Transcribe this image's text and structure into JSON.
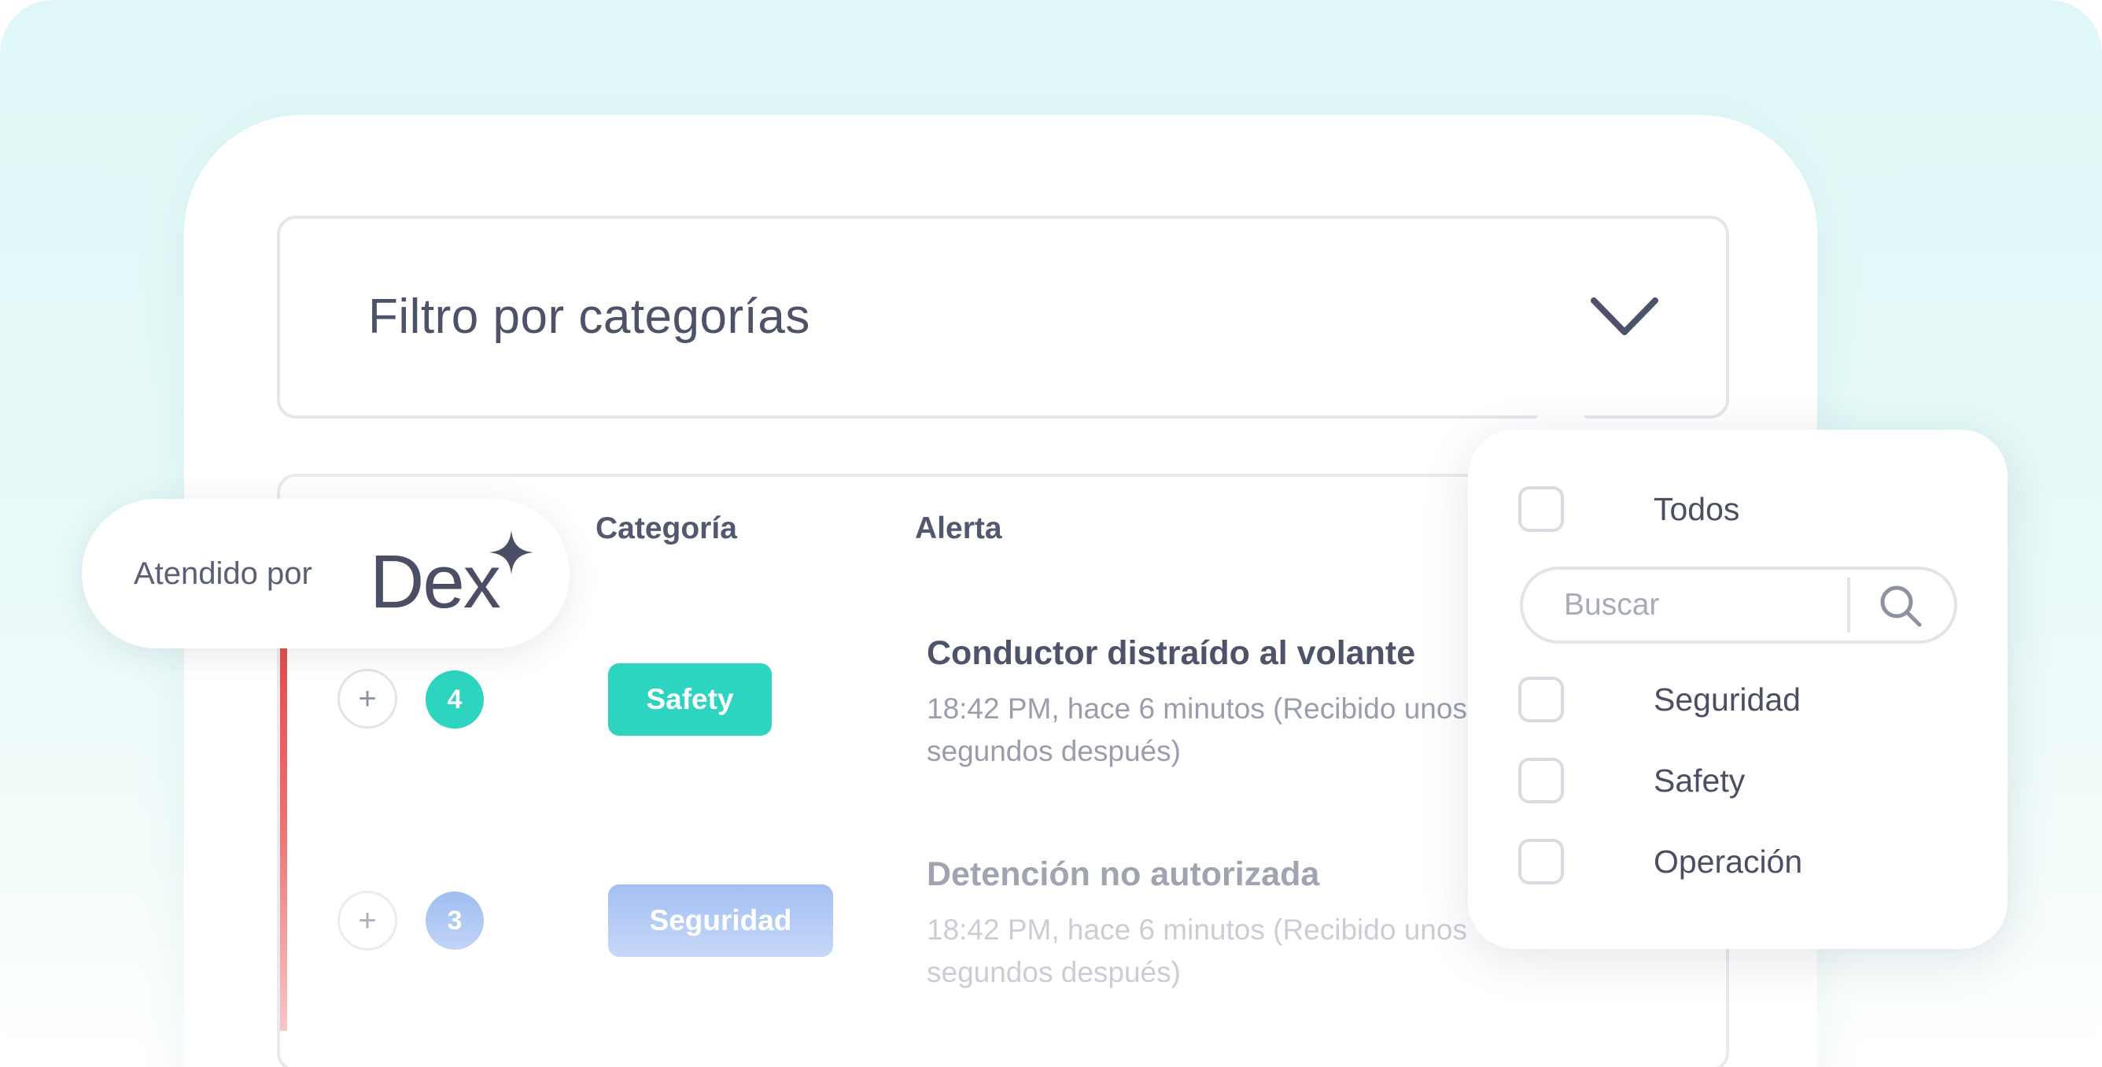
{
  "filter": {
    "title": "Filtro por categorías"
  },
  "table": {
    "columns": {
      "category": "Categoría",
      "alert": "Alerta"
    },
    "rows": [
      {
        "plus": "+",
        "count": "4",
        "tag": "Safety",
        "title": "Conductor distraído al volante",
        "subtitle": "18:42 PM, hace 6 minutos (Recibido unos segundos después)"
      },
      {
        "plus": "+",
        "count": "3",
        "tag": "Seguridad",
        "title": "Detención no autorizada",
        "subtitle": "18:42 PM, hace 6 minutos (Recibido unos segundos después)"
      }
    ]
  },
  "badge": {
    "label": "Atendido por",
    "brand": "Dex"
  },
  "dropdown": {
    "items": [
      "Todos",
      "Seguridad",
      "Safety",
      "Operación"
    ],
    "search_placeholder": "Buscar"
  },
  "colors": {
    "safety": "#2dd4bf",
    "seguridad": "#8fb1ef",
    "alert_bar": "#e24b4b"
  }
}
